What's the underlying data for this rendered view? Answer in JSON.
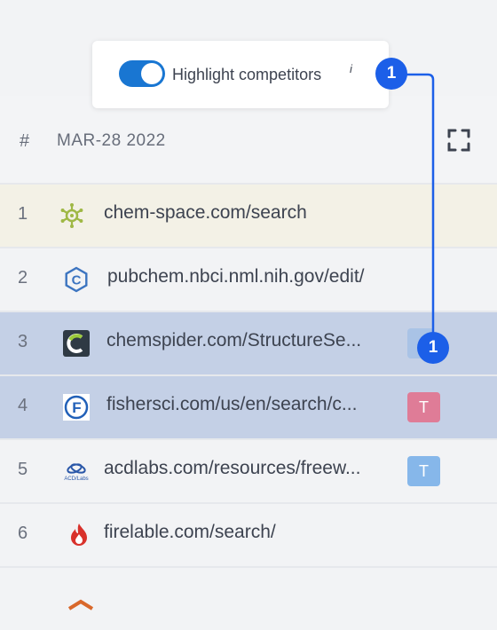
{
  "header": {
    "hash": "#",
    "date": "MAR-28 2022"
  },
  "popup": {
    "toggle_on": true,
    "label": "Highlight competitors",
    "info": "i"
  },
  "markers": {
    "top": "1",
    "row3": "1"
  },
  "rows": [
    {
      "num": "1",
      "url": "chem-space.com/search",
      "icon": "chem-space-icon",
      "bg": "#f3f1e6"
    },
    {
      "num": "2",
      "url": "pubchem.nbci.nml.nih.gov/edit/",
      "icon": "pubchem-icon",
      "bg": "#f2f3f5"
    },
    {
      "num": "3",
      "url": "chemspider.com/StructureSe...",
      "icon": "chemspider-icon",
      "bg": "#c4d0e6"
    },
    {
      "num": "4",
      "url": "fishersci.com/us/en/search/c...",
      "icon": "fishersci-icon",
      "bg": "#c4d0e6",
      "badge": "T",
      "badge_color": "#df7c97"
    },
    {
      "num": "5",
      "url": "acdlabs.com/resources/freew...",
      "icon": "acdlabs-icon",
      "bg": "#f2f3f5",
      "badge": "T",
      "badge_color": "#86b7ea"
    },
    {
      "num": "6",
      "url": "firelable.com/search/",
      "icon": "firelable-icon",
      "bg": "#f2f3f5"
    }
  ],
  "colors": {
    "accent": "#1c5fe8",
    "toggle": "#1976d2"
  }
}
